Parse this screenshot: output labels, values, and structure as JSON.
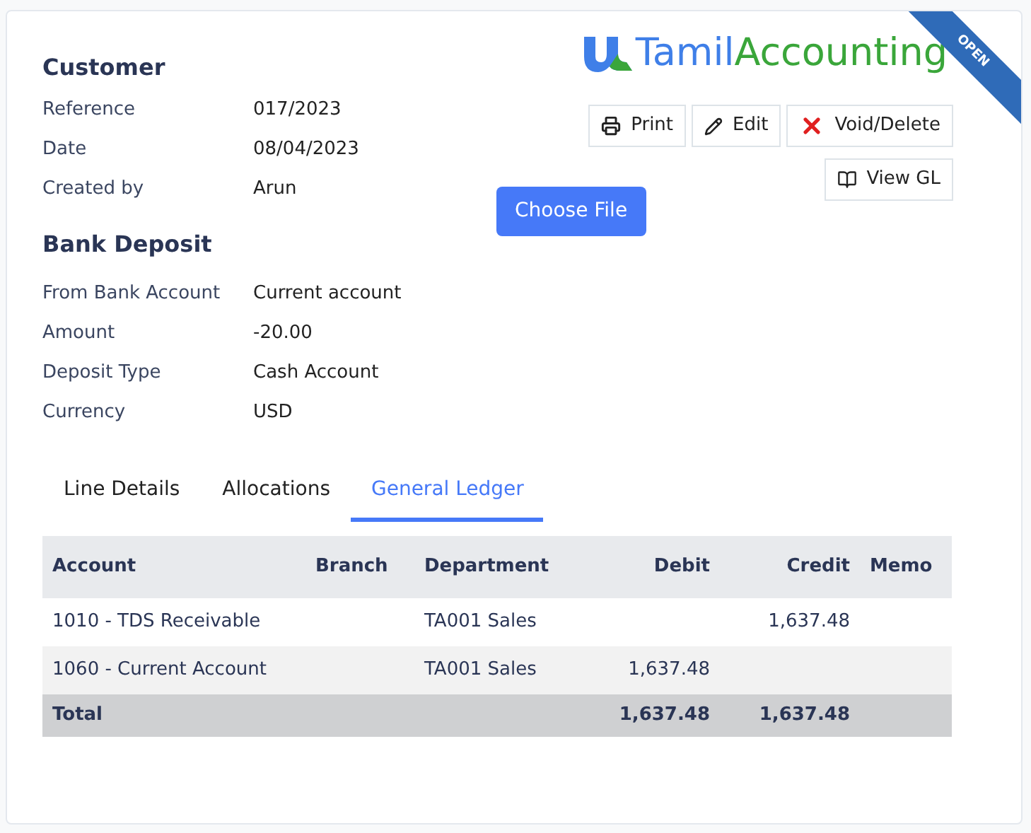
{
  "ribbon": "OPEN",
  "logo": {
    "part_1": "Tamil",
    "part_2": "Accounting"
  },
  "customer": {
    "title": "Customer",
    "fields": [
      {
        "label": "Reference",
        "value": "017/2023"
      },
      {
        "label": "Date",
        "value": "08/04/2023"
      },
      {
        "label": "Created by",
        "value": "Arun"
      }
    ]
  },
  "actions": [
    {
      "kind": "print",
      "label": "Print"
    },
    {
      "kind": "edit",
      "label": "Edit"
    },
    {
      "kind": "delete",
      "label": "Void/Delete"
    },
    {
      "kind": "gl",
      "label": "View GL"
    }
  ],
  "choose_file": "Choose File",
  "deposit": {
    "title": "Bank Deposit",
    "fields": [
      {
        "label": "From Bank Account",
        "value": "Current account"
      },
      {
        "label": "Amount",
        "value": "-20.00"
      },
      {
        "label": "Deposit Type",
        "value": "Cash Account"
      },
      {
        "label": "Currency",
        "value": "USD"
      }
    ]
  },
  "tabs": [
    {
      "label": "Line Details",
      "selected": false
    },
    {
      "label": "Allocations",
      "selected": false
    },
    {
      "label": "General Ledger",
      "selected": true
    }
  ],
  "table": {
    "columns": [
      "Account",
      "Branch",
      "Department",
      "Debit",
      "Credit",
      "Memo"
    ],
    "rows": [
      {
        "account": "1010 - TDS Receivable",
        "department": "TA001 Sales",
        "credit": "1,637.48"
      },
      {
        "account": "1060 - Current Account",
        "department": "TA001 Sales",
        "debit": "1,637.48"
      }
    ],
    "total": {
      "label": "Total",
      "debit": "1,637.48",
      "credit": "1,637.48"
    }
  }
}
